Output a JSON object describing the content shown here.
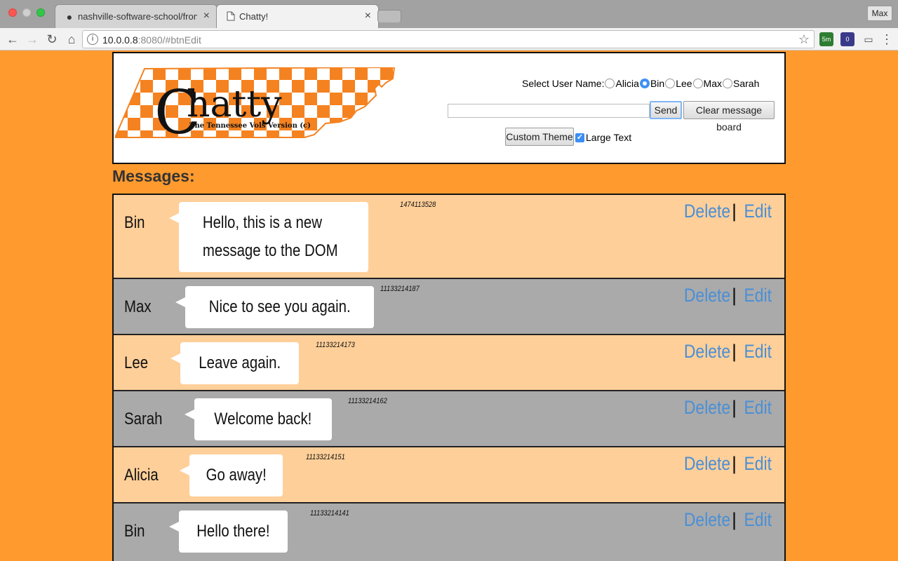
{
  "browser": {
    "tabs": [
      {
        "title": "nashville-software-school/fron",
        "icon": "github-icon"
      },
      {
        "title": "Chatty!",
        "icon": "page-icon"
      }
    ],
    "profile_label": "Max",
    "url_host": "10.0.0.8",
    "url_rest": ":8080/#btnEdit",
    "extensions": [
      {
        "name": "5m",
        "color": "#2e7d32"
      },
      {
        "name": "0",
        "color": "#3a3a8a"
      }
    ]
  },
  "header": {
    "logo_title": "Chatty",
    "logo_subtitle": "The Tennessee Vols Version (c)",
    "select_user_label": "Select User Name:",
    "users": [
      "Alicia",
      "Bin",
      "Lee",
      "Max",
      "Sarah"
    ],
    "selected_user": "Bin",
    "message_input_value": "",
    "send_label": "Send",
    "clear_label": "Clear message board",
    "custom_theme_label": "Custom Theme",
    "large_text_label": "Large Text",
    "large_text_checked": true
  },
  "messages_title": "Messages:",
  "messages": [
    {
      "user": "Bin",
      "text": "Hello, this is a new message to the DOM",
      "timestamp": "1474113528",
      "shade": "light"
    },
    {
      "user": "Max",
      "text": "Nice to see you again.",
      "timestamp": "11133214187",
      "shade": "gray"
    },
    {
      "user": "Lee",
      "text": "Leave again.",
      "timestamp": "11133214173",
      "shade": "light"
    },
    {
      "user": "Sarah",
      "text": "Welcome back!",
      "timestamp": "11133214162",
      "shade": "gray"
    },
    {
      "user": "Alicia",
      "text": "Go away!",
      "timestamp": "11133214151",
      "shade": "light"
    },
    {
      "user": "Bin",
      "text": "Hello there!",
      "timestamp": "11133214141",
      "shade": "gray"
    }
  ],
  "actions": {
    "delete_label": "Delete",
    "separator": "|",
    "edit_label": "Edit"
  },
  "colors": {
    "page_bg": "#ff9a2e",
    "row_light": "#ffcf99",
    "row_gray": "#aaaaaa",
    "link": "#4a8fd6",
    "logo_orange": "#f58220"
  }
}
